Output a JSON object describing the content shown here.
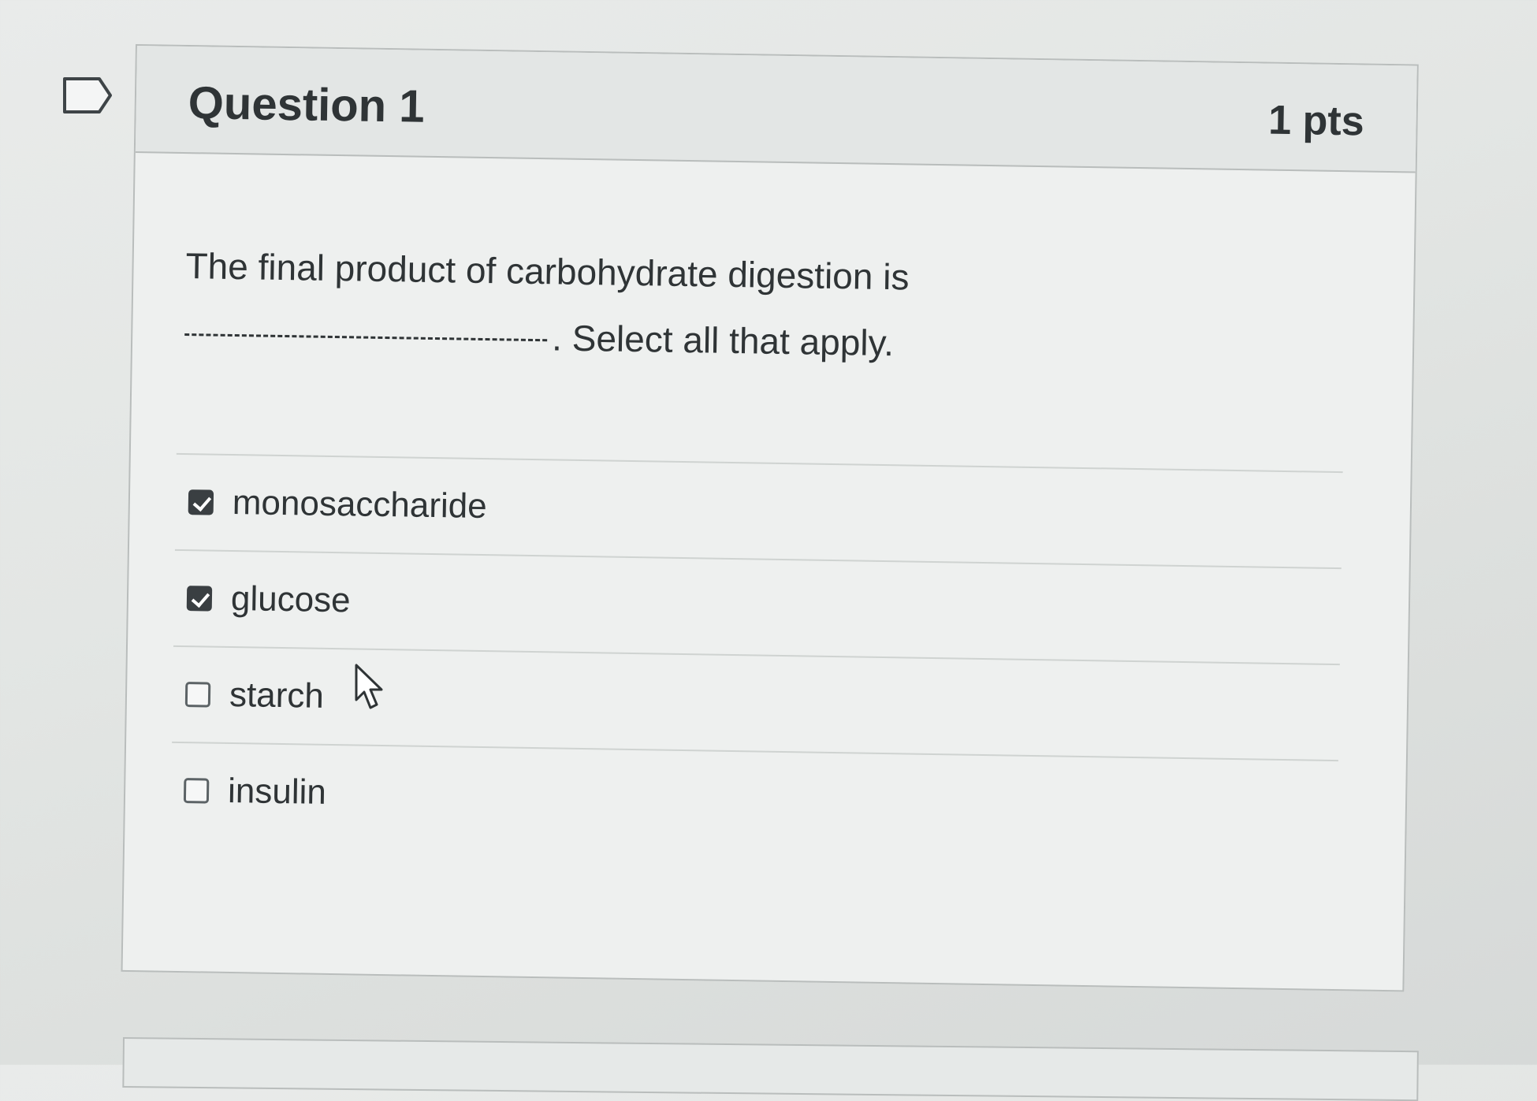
{
  "question": {
    "title": "Question 1",
    "points": "1 pts",
    "text_line1": "The final product of carbohydrate digestion is",
    "text_line2": ". Select all that apply."
  },
  "answers": [
    {
      "label": "monosaccharide",
      "checked": true
    },
    {
      "label": "glucose",
      "checked": true
    },
    {
      "label": "starch",
      "checked": false
    },
    {
      "label": "insulin",
      "checked": false
    }
  ],
  "icons": {
    "flag": "flag-question-icon",
    "cursor": "mouse-pointer-icon",
    "checkmark": "checkmark-icon"
  },
  "colors": {
    "text": "#2f3436",
    "header_bg": "#e3e6e5",
    "border": "#b9bdbc",
    "checked_box": "#3a3f42"
  }
}
